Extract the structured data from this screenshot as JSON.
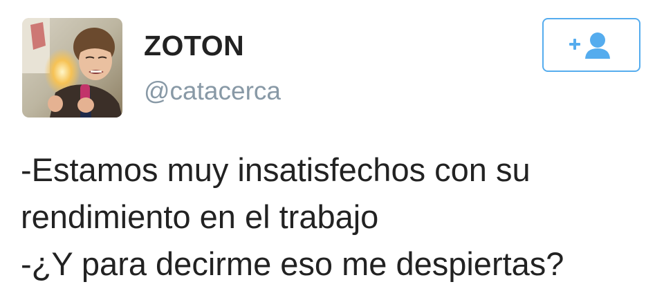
{
  "profile": {
    "display_name": "ZOTON",
    "handle": "@catacerca",
    "avatar_icon": "child-avatar-photo"
  },
  "follow_button": {
    "icon": "add-user-icon",
    "accent_color": "#55acee"
  },
  "tweet": {
    "lines": [
      "-Estamos muy insatisfechos con su",
      "rendimiento en el trabajo",
      "-¿Y para decirme eso me despiertas?"
    ]
  }
}
